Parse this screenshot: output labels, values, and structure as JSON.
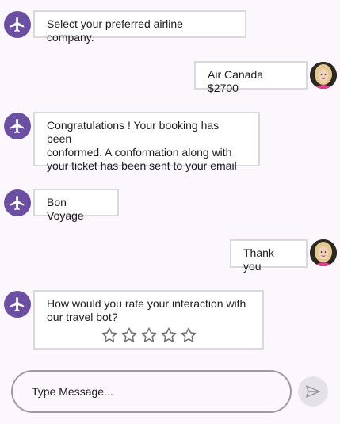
{
  "messages": [
    {
      "sender": "bot",
      "text": "Select your preferred airline company."
    },
    {
      "sender": "user",
      "text": "Air Canada $2700"
    },
    {
      "sender": "bot",
      "text": "Congratulations ! Your booking has been\nconformed. A conformation along with\nyour ticket has been sent to your email"
    },
    {
      "sender": "bot",
      "text": "Bon Voyage"
    },
    {
      "sender": "user",
      "text": "Thank you"
    },
    {
      "sender": "bot",
      "text": "How would you rate your interaction with\nour travel bot?",
      "rating": {
        "max": 5,
        "value": 0
      }
    }
  ],
  "composer": {
    "placeholder": "Type Message..."
  },
  "icons": {
    "bot_avatar": "airplane-icon",
    "send": "send-icon",
    "rating": "star-outline-icon"
  },
  "colors": {
    "bot_avatar": "#6b4fa3",
    "background": "#fcf7fd",
    "bubble_border": "#d9d9dc",
    "star": "#6f6b72"
  }
}
